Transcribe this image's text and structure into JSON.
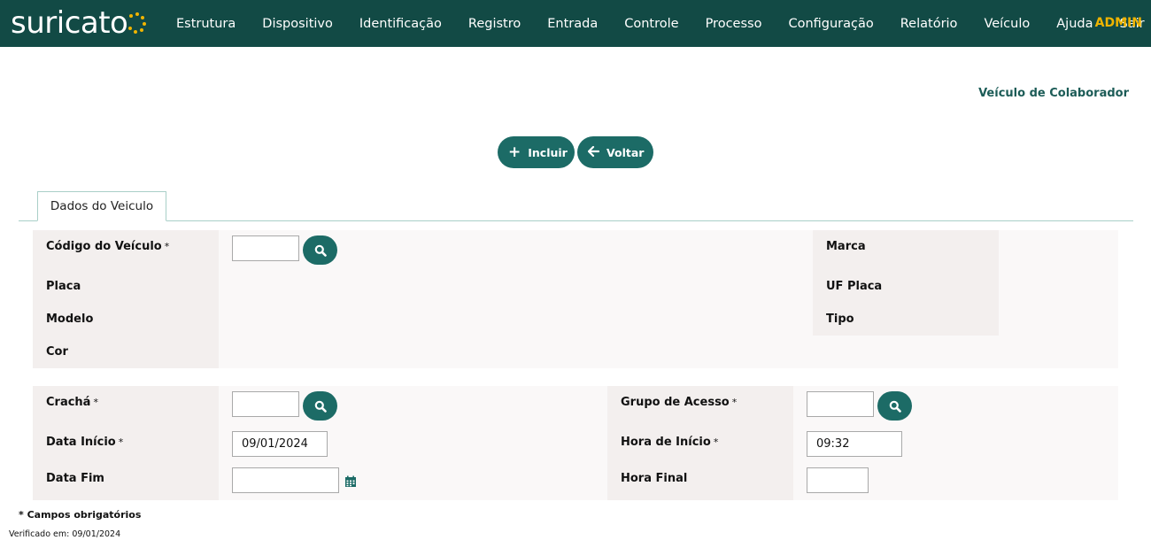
{
  "header": {
    "logo_text": "suricato",
    "nav": [
      "Estrutura",
      "Dispositivo",
      "Identificação",
      "Registro",
      "Entrada",
      "Controle",
      "Processo",
      "Configuração",
      "Relatório",
      "Veículo",
      "Ajuda",
      "Sair"
    ],
    "user": "ADMIN",
    "colors": {
      "bar": "#124a45",
      "accent": "#f0b400"
    }
  },
  "page": {
    "title": "Veículo de Colaborador"
  },
  "actions": {
    "incluir": "Incluir",
    "voltar": "Voltar"
  },
  "tabs": [
    {
      "label": "Dados do Veiculo",
      "active": true
    }
  ],
  "vehicle": {
    "codigo_label": "Código do Veículo",
    "codigo_value": "",
    "placa_label": "Placa",
    "modelo_label": "Modelo",
    "cor_label": "Cor",
    "marca_label": "Marca",
    "uf_placa_label": "UF Placa",
    "tipo_label": "Tipo"
  },
  "access": {
    "cracha_label": "Crachá",
    "cracha_value": "",
    "data_inicio_label": "Data Início",
    "data_inicio_value": "09/01/2024",
    "data_fim_label": "Data Fim",
    "data_fim_value": "",
    "grupo_label": "Grupo de Acesso",
    "grupo_value": "",
    "hora_inicio_label": "Hora de Início",
    "hora_inicio_value": "09:32",
    "hora_final_label": "Hora Final",
    "hora_final_value": ""
  },
  "required_mark": "*",
  "footer": {
    "required_note": "* Campos obrigatórios",
    "verified": "Verificado em: 09/01/2024"
  },
  "icons": [
    "plus-icon",
    "arrow-left-icon",
    "search-icon",
    "calendar-icon"
  ],
  "colors": {
    "button": "#1c6b66",
    "title": "#1c5c57",
    "label_bg": "#f3efee",
    "panel_bg": "#faf8f8"
  }
}
